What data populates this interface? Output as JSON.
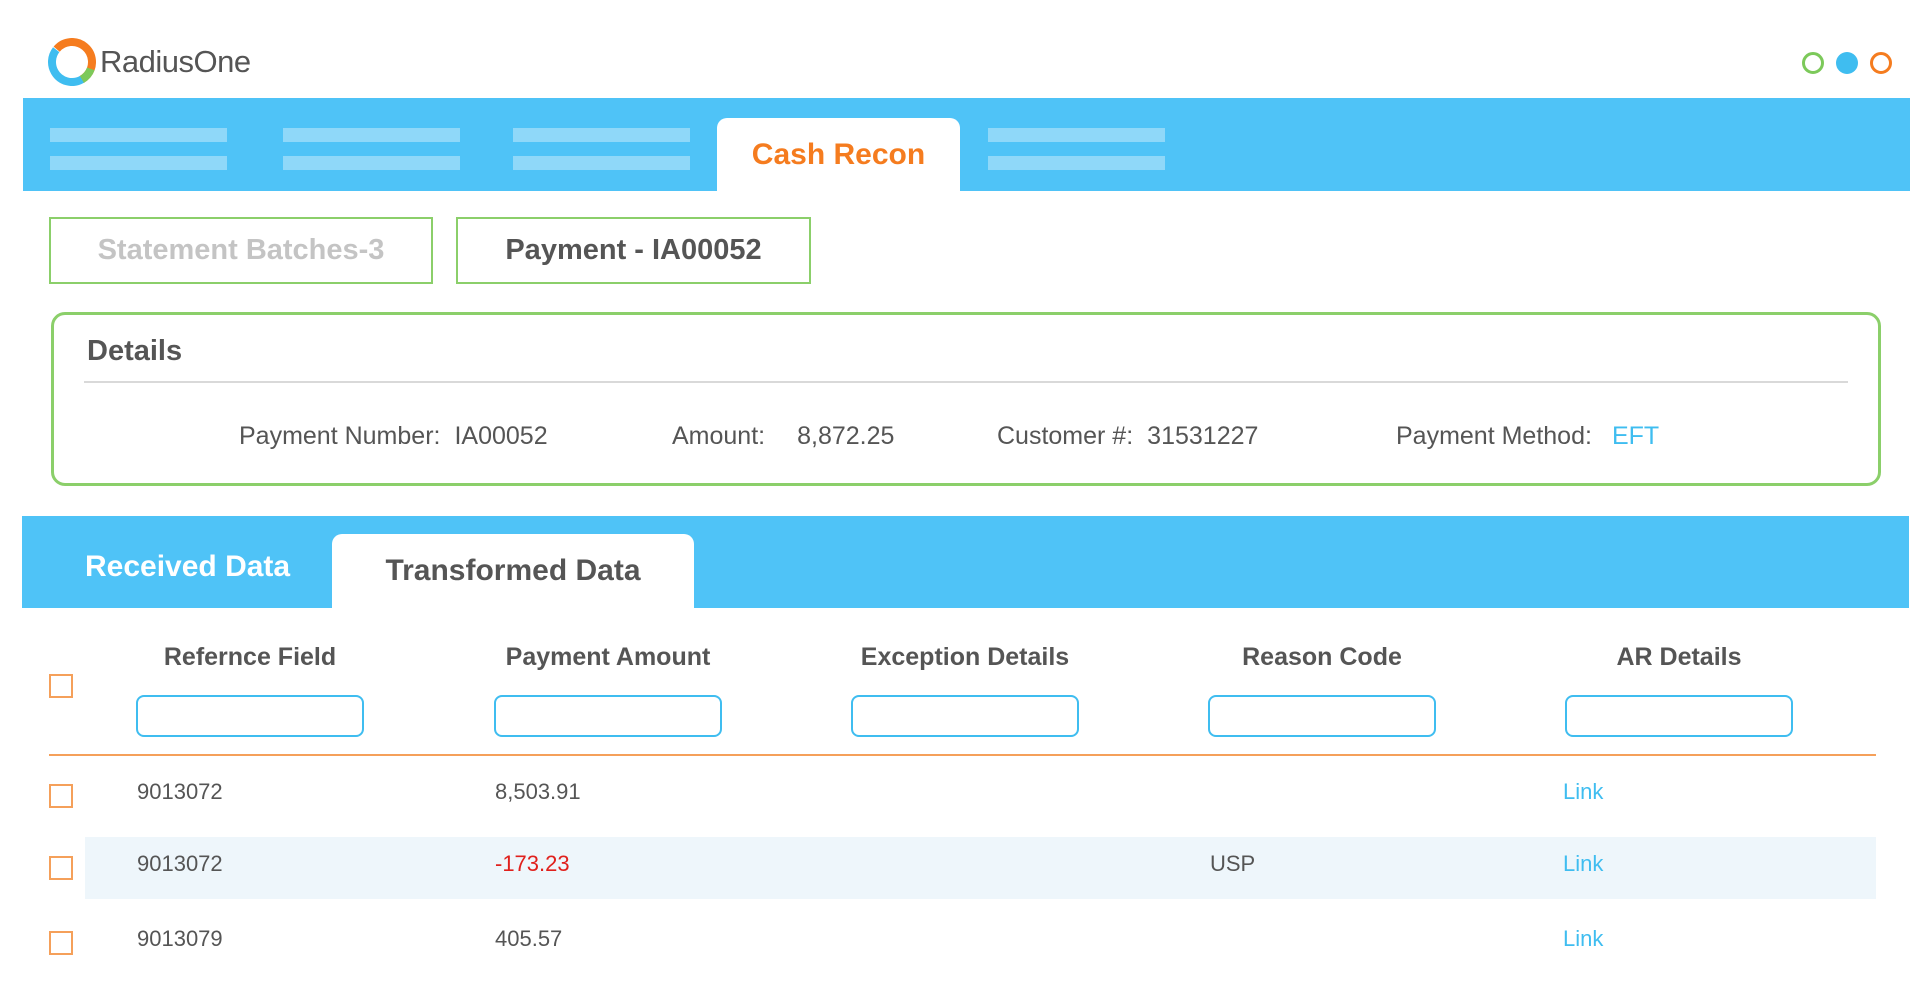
{
  "app": {
    "name": "RadiusOne"
  },
  "colors": {
    "accent_blue": "#4fc3f7",
    "accent_orange": "#f57c1f",
    "accent_green": "#8bcf6a",
    "negative": "#e0201c"
  },
  "nav": {
    "active_tab": "Cash Recon"
  },
  "breadcrumb": {
    "item1": "Statement Batches-3",
    "item2": "Payment - IA00052"
  },
  "details": {
    "title": "Details",
    "payment_number_label": "Payment Number:",
    "payment_number": "IA00052",
    "amount_label": "Amount:",
    "amount": "8,872.25",
    "customer_label": "Customer #:",
    "customer": "31531227",
    "method_label": "Payment Method:",
    "method": "EFT"
  },
  "data_tabs": {
    "received": "Received Data",
    "transformed": "Transformed Data"
  },
  "table": {
    "headers": [
      "Refernce Field",
      "Payment Amount",
      "Exception Details",
      "Reason Code",
      "AR Details"
    ],
    "rows": [
      {
        "reference": "9013072",
        "amount": "8,503.91",
        "exception": "",
        "reason": "",
        "ar": "Link"
      },
      {
        "reference": "9013072",
        "amount": "-173.23",
        "exception": "",
        "reason": "USP",
        "ar": "Link"
      },
      {
        "reference": "9013079",
        "amount": "405.57",
        "exception": "",
        "reason": "",
        "ar": "Link"
      }
    ]
  }
}
